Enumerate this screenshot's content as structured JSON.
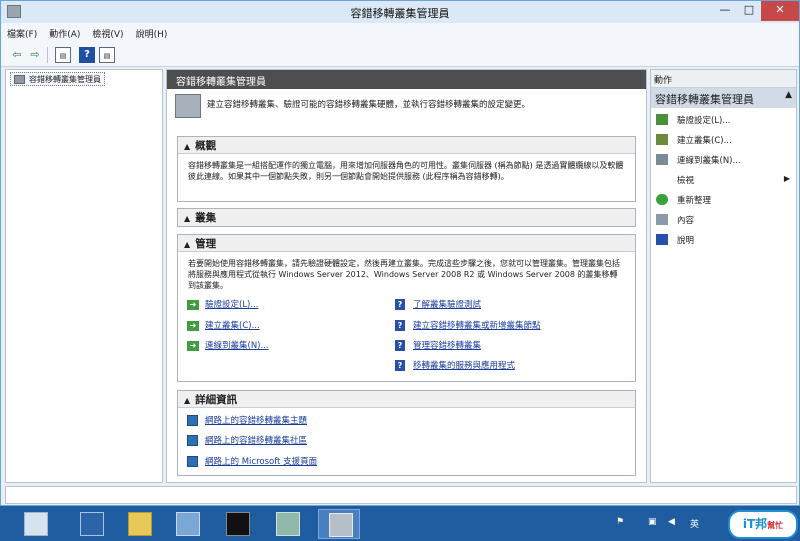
{
  "window": {
    "title": "容錯移轉叢集管理員",
    "min_glyph": "—",
    "max_glyph": "□",
    "close_glyph": "✕"
  },
  "menu": [
    "檔案(F)",
    "動作(A)",
    "檢視(V)",
    "說明(H)"
  ],
  "toolbar": {
    "back_glyph": "⇦",
    "forward_glyph": "⇨",
    "help_glyph": "?",
    "pane_glyph": "▤"
  },
  "tree": {
    "root_label": "容錯移轉叢集管理員"
  },
  "center": {
    "header": "容錯移轉叢集管理員",
    "intro": "建立容錯移轉叢集、驗證可能的容錯移轉叢集硬體，並執行容錯移轉叢集的設定變更。",
    "overview": {
      "title": "概觀",
      "text": "容錯移轉叢集是一組搭配運作的獨立電腦，用來增加伺服器角色的可用性。叢集伺服器 (稱為節點) 是透過實體纜線以及軟體彼此連線。如果其中一個節點失敗，則另一個節點會開始提供服務 (此程序稱為容錯移轉)。"
    },
    "clusters": {
      "title": "叢集"
    },
    "management": {
      "title": "管理",
      "text": "若要開始使用容錯移轉叢集，請先驗證硬體設定，然後再建立叢集。完成這些步驟之後，您就可以管理叢集。管理叢集包括將服務與應用程式從執行 Windows Server 2012、Windows Server 2008 R2 或 Windows Server 2008 的叢集移轉到該叢集。",
      "left_links": [
        "驗證設定(L)...",
        "建立叢集(C)...",
        "連線到叢集(N)..."
      ],
      "right_links": [
        "了解叢集驗證測試",
        "建立容錯移轉叢集或新增叢集節點",
        "管理容錯移轉叢集",
        "移轉叢集的服務與應用程式"
      ]
    },
    "details": {
      "title": "詳細資訊",
      "links": [
        "網路上的容錯移轉叢集主題",
        "網路上的容錯移轉叢集社區",
        "網路上的 Microsoft 支援頁面"
      ]
    },
    "collapse_glyph": "▲"
  },
  "actions": {
    "title": "動作",
    "group": "容錯移轉叢集管理員",
    "group_glyph": "▲",
    "items": [
      {
        "label": "驗證設定(L)...",
        "color": "#4b8f3a"
      },
      {
        "label": "建立叢集(C)...",
        "color": "#6c8a3e"
      },
      {
        "label": "連線到叢集(N)...",
        "color": "#7c8a96"
      },
      {
        "label": "檢視",
        "color": "#ffffff"
      },
      {
        "label": "重新整理",
        "color": "#3aa23a"
      },
      {
        "label": "內容",
        "color": "#8a9aa9"
      },
      {
        "label": "說明",
        "color": "#2850a8"
      }
    ],
    "submenu_glyph": "▶"
  },
  "taskbar": {
    "tray_text": "英",
    "brand": "iT邦",
    "brand_small": "幫忙"
  },
  "colors": {
    "taskbar": "#1f5da0",
    "close": "#c74848",
    "link": "#1a3c9c"
  }
}
